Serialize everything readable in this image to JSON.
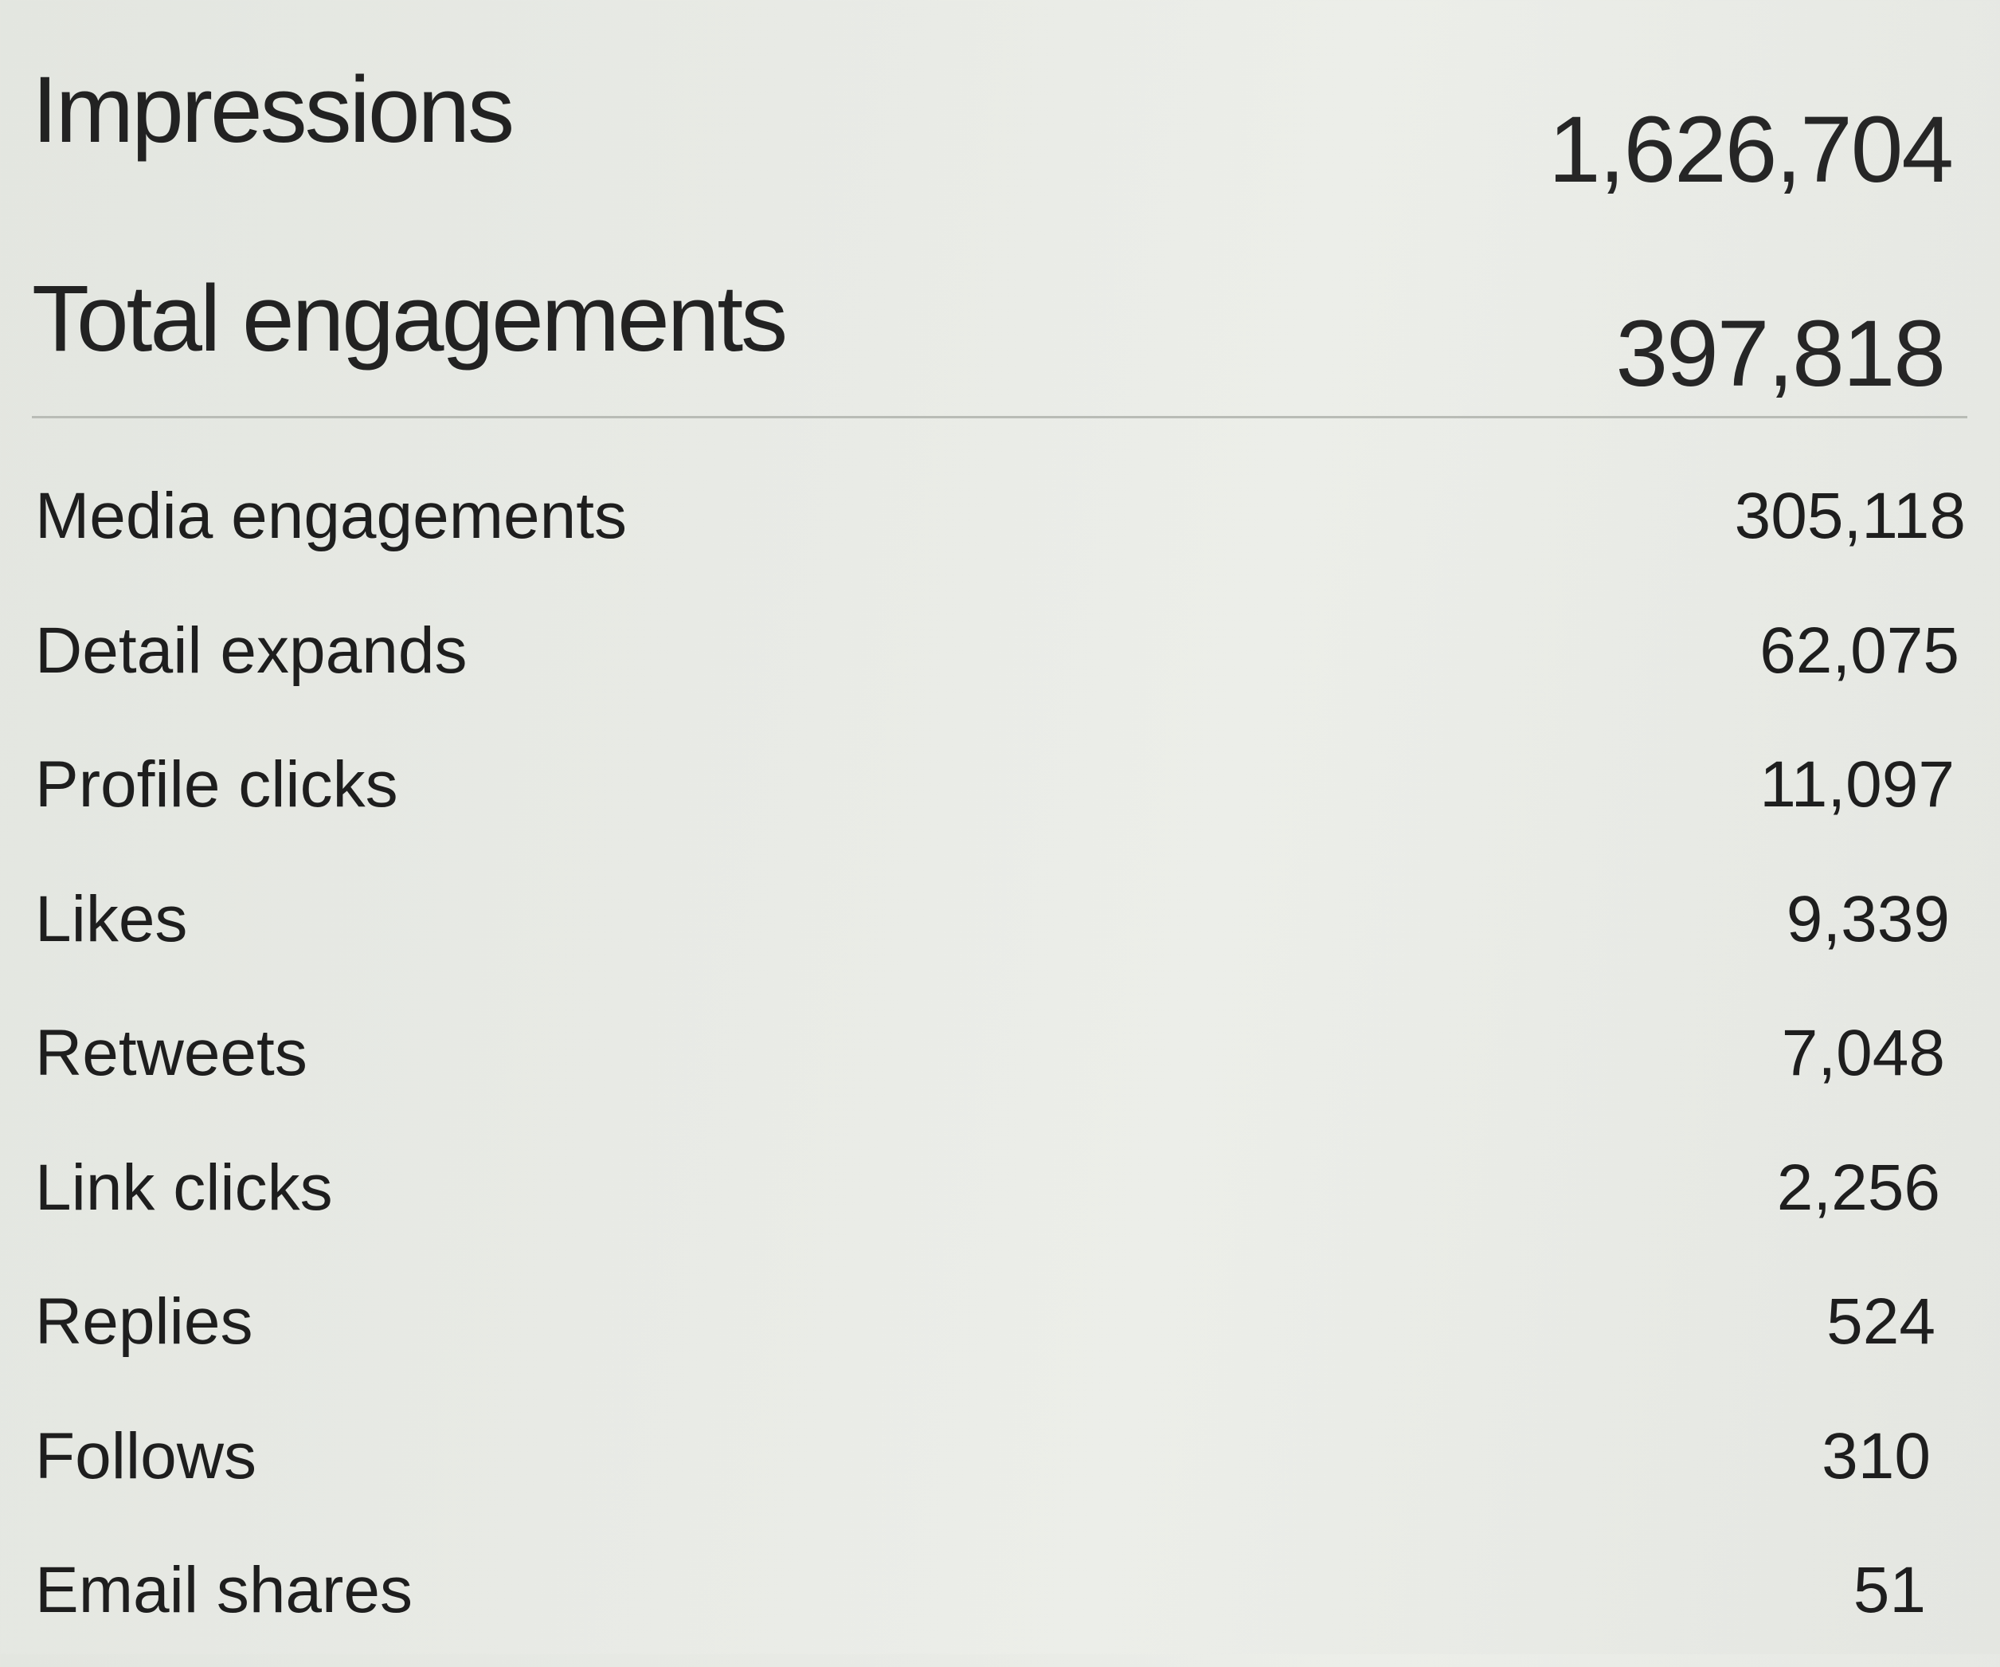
{
  "summary": {
    "impressions": {
      "label": "Impressions",
      "value": "1,626,704"
    },
    "total_engagements": {
      "label": "Total engagements",
      "value": "397,818"
    }
  },
  "details": [
    {
      "label": "Media engagements",
      "value": "305,118"
    },
    {
      "label": "Detail expands",
      "value": "62,075"
    },
    {
      "label": "Profile clicks",
      "value": "11,097"
    },
    {
      "label": "Likes",
      "value": "9,339"
    },
    {
      "label": "Retweets",
      "value": "7,048"
    },
    {
      "label": "Link clicks",
      "value": "2,256"
    },
    {
      "label": "Replies",
      "value": "524"
    },
    {
      "label": "Follows",
      "value": "310"
    },
    {
      "label": "Email shares",
      "value": "51"
    }
  ]
}
